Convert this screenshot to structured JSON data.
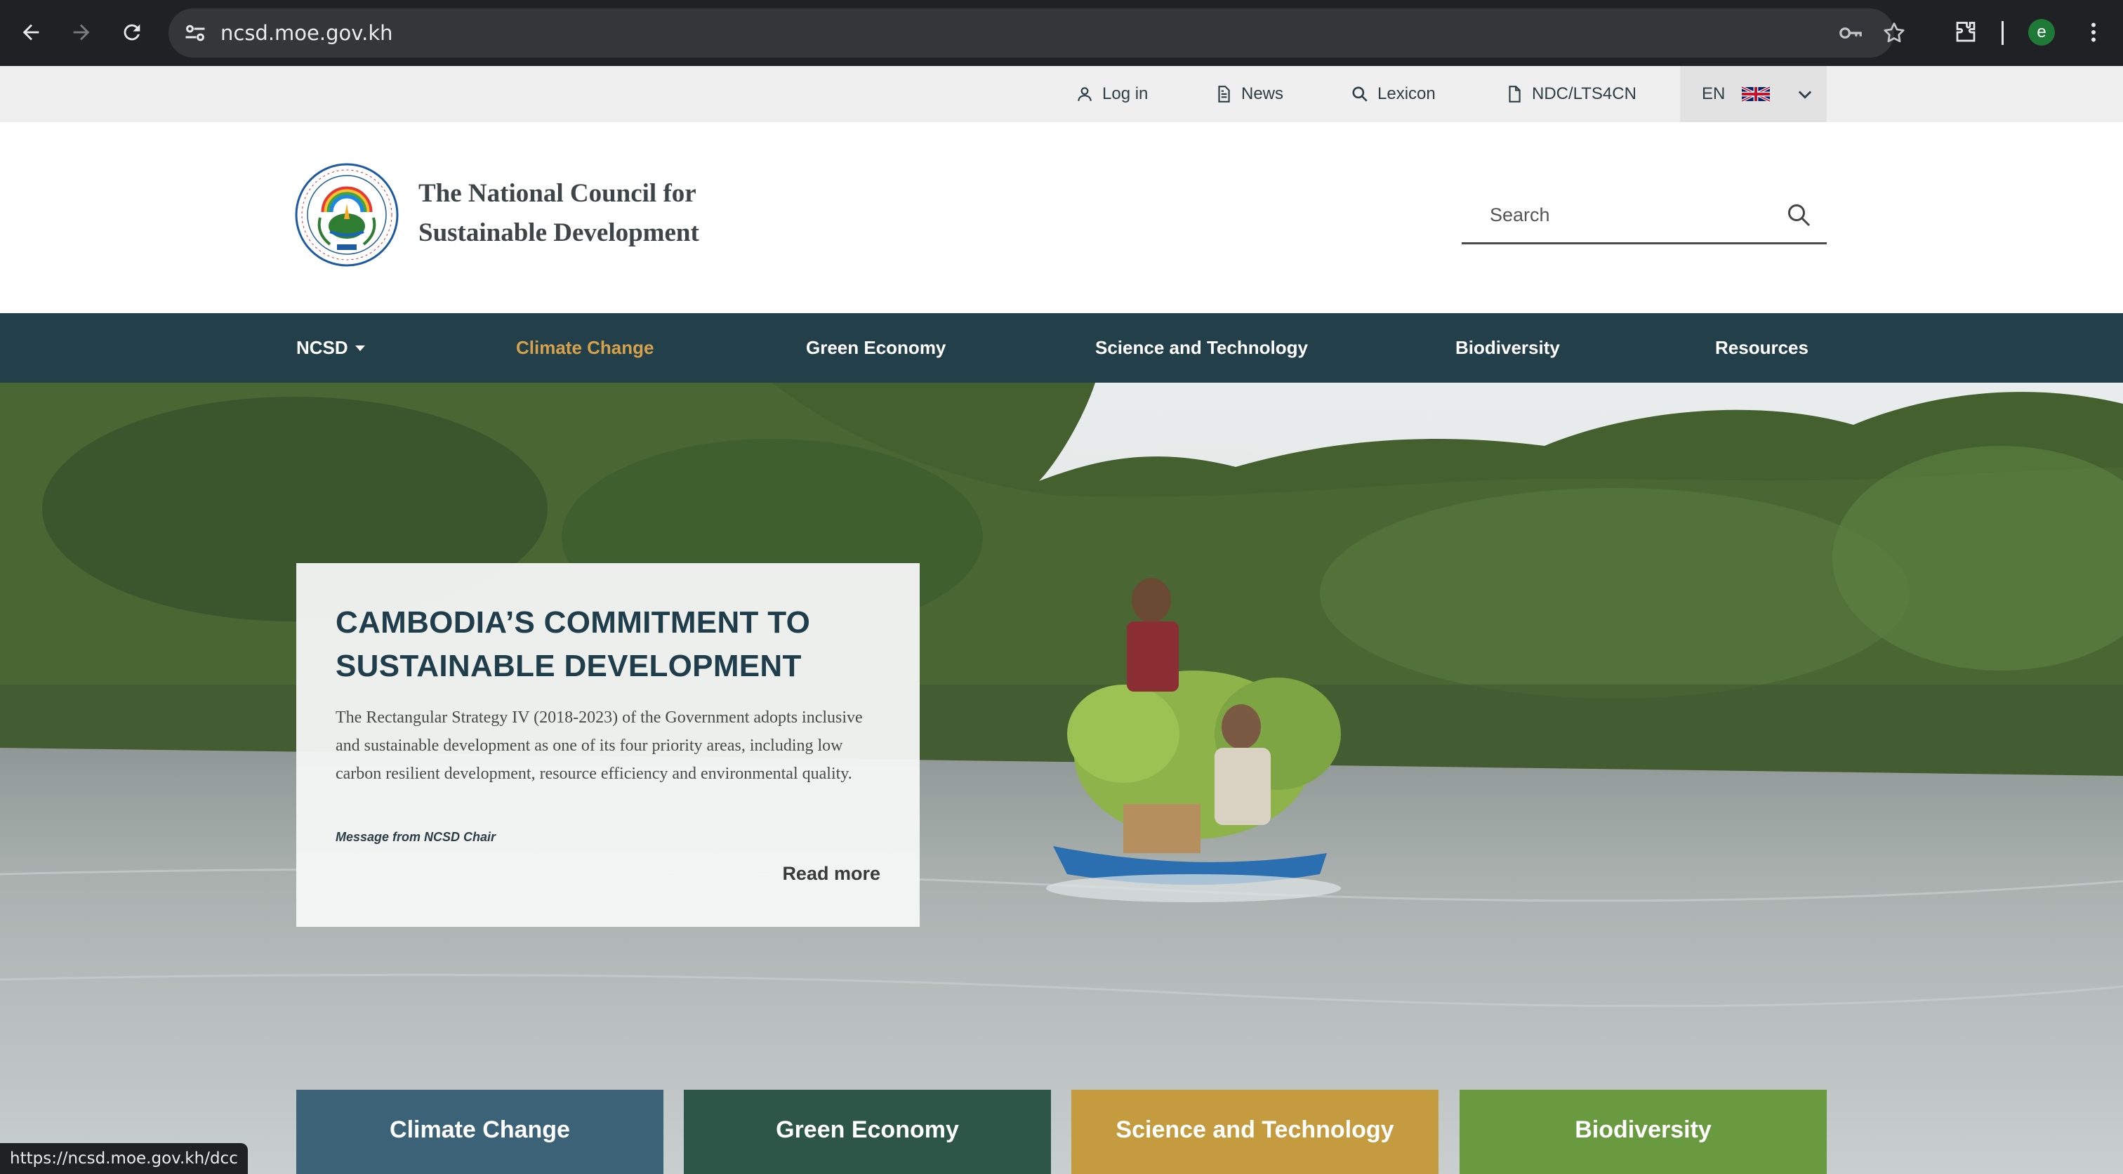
{
  "browser": {
    "url": "ncsd.moe.gov.kh",
    "status_url": "https://ncsd.moe.gov.kh/dcc",
    "profile_initial": "e"
  },
  "utility": {
    "login": "Log in",
    "news": "News",
    "lexicon": "Lexicon",
    "ndc": "NDC/LTS4CN",
    "language": "EN"
  },
  "header": {
    "org_line1": "The National Council for",
    "org_line2": "Sustainable Development",
    "search_placeholder": "Search"
  },
  "nav": {
    "items": [
      {
        "label": "NCSD",
        "has_dropdown": true
      },
      {
        "label": "Climate Change",
        "active": true
      },
      {
        "label": "Green Economy"
      },
      {
        "label": "Science and Technology"
      },
      {
        "label": "Biodiversity"
      },
      {
        "label": "Resources"
      }
    ],
    "active_color": "#d4a24c",
    "background": "#233f49"
  },
  "hero": {
    "title_line1": "CAMBODIA’S COMMITMENT TO",
    "title_line2": "SUSTAINABLE DEVELOPMENT",
    "body": "The Rectangular Strategy IV (2018-2023) of the Government adopts inclusive and sustainable development as one of its four priority areas, including low carbon resilient development, resource efficiency and environmental quality.",
    "message_link": "Message from NCSD Chair",
    "read_more": "Read more"
  },
  "tiles": [
    {
      "label": "Climate Change",
      "color": "#3c6278"
    },
    {
      "label": "Green Economy",
      "color": "#2d5548"
    },
    {
      "label": "Science and Technology",
      "color": "#c49c3f"
    },
    {
      "label": "Biodiversity",
      "color": "#6a9a3f"
    }
  ]
}
